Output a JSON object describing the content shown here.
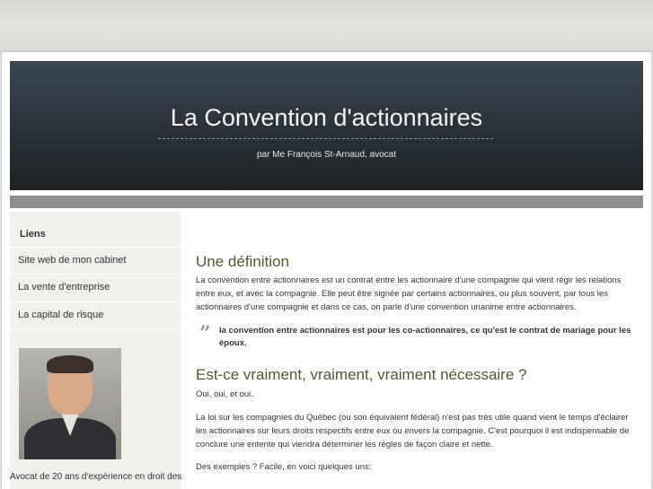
{
  "header": {
    "title": "La Convention d'actionnaires",
    "subtitle": "par Me François St-Arnaud, avocat"
  },
  "sidebar": {
    "heading": "Liens",
    "items": [
      {
        "label": "Site web de mon cabinet"
      },
      {
        "label": "La vente d'entreprise"
      },
      {
        "label": "La capital de risque"
      }
    ],
    "bio": "Avocat de 20 ans d'expérience en droit des"
  },
  "main": {
    "section1_title": "Une définition",
    "section1_text": "La convention entre actionnaires est un contrat entre les actionnaire d'une compagnie qui vient régir les relations entre eux, et avec la compagnie. Elle peut être signée par certains actionnaires, ou plus souvent, par tous les actionnaires d'une compagnie et dans ce cas, on parle d'une convention unanime entre actionnaires.",
    "quote_mark": "”",
    "quote": "la convention entre actionnaires est pour les co-actionnaires, ce qu'est le contrat de mariage pour les époux.",
    "section2_title": "Est-ce vraiment, vraiment, vraiment nécessaire ?",
    "section2_p1": "Oui, oui, et oui.",
    "section2_p2": "La loi sur les compagnies du Québec (ou son équivalent fédéral) n'est pas très utile quand vient le temps d'éclairer les actionnaires sur leurs droits respectifs entre eux ou envers la compagnie. C'est pourquoi il est indispensable de conclure une entente qui viendra déterminer les règles de façon claire et nette.",
    "section2_p3": "Des exemples ? Facile, en voici quelques uns:"
  }
}
